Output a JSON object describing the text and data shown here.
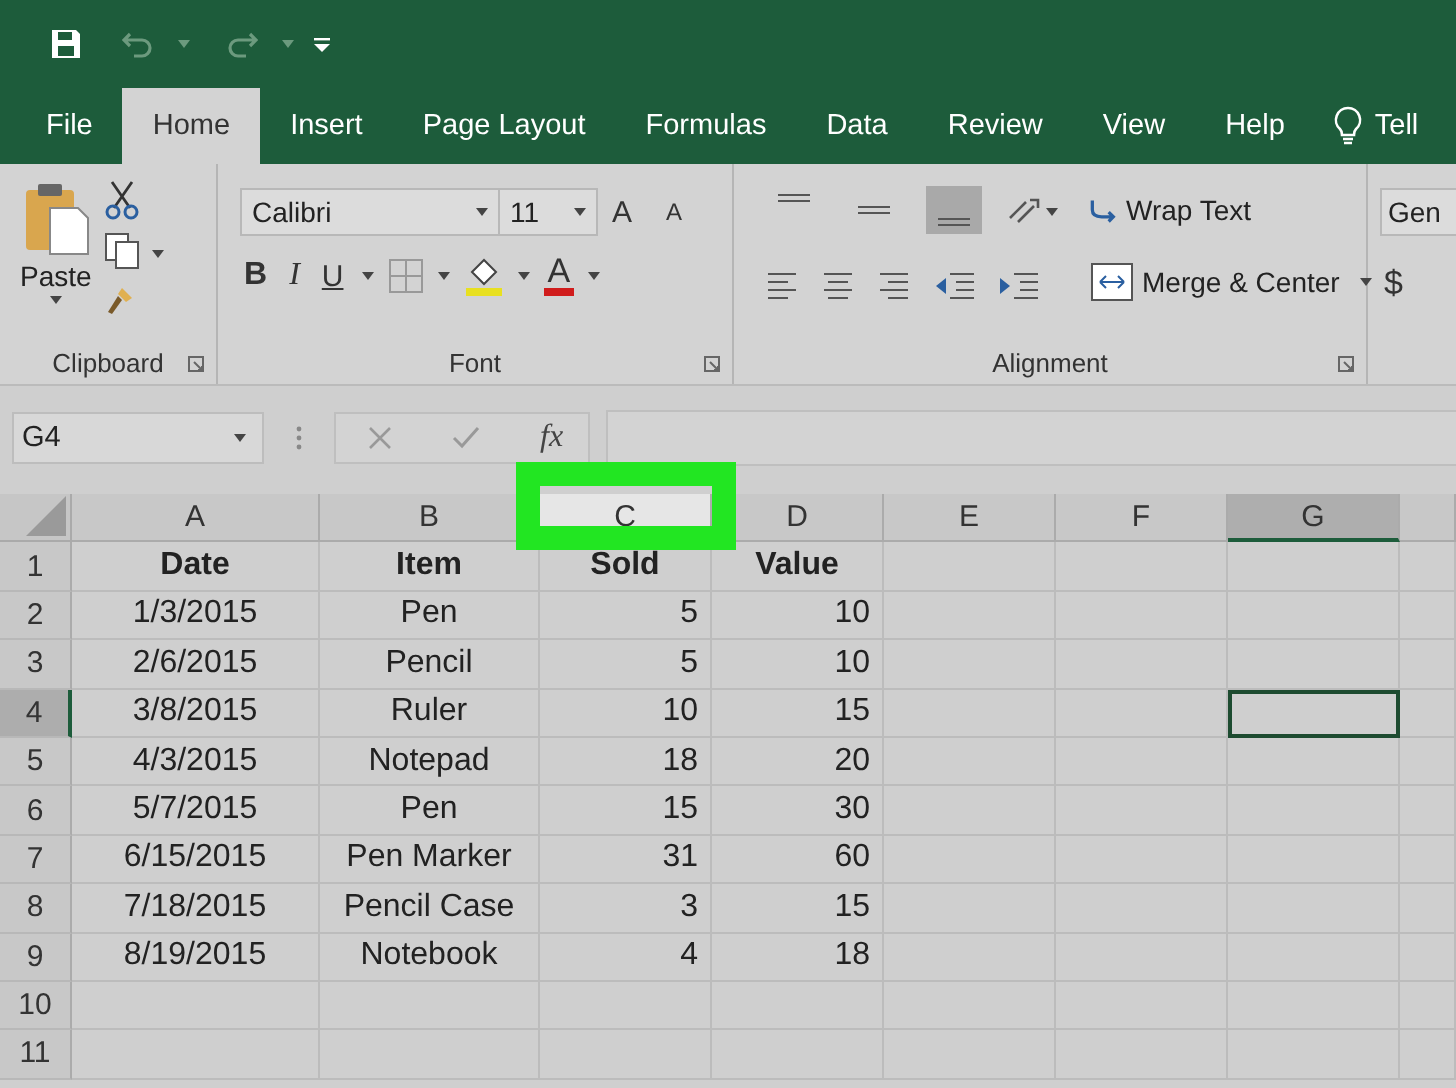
{
  "tabs": [
    {
      "label": "File",
      "selected": false
    },
    {
      "label": "Home",
      "selected": true
    },
    {
      "label": "Insert",
      "selected": false
    },
    {
      "label": "Page Layout",
      "selected": false
    },
    {
      "label": "Formulas",
      "selected": false
    },
    {
      "label": "Data",
      "selected": false
    },
    {
      "label": "Review",
      "selected": false
    },
    {
      "label": "View",
      "selected": false
    },
    {
      "label": "Help",
      "selected": false
    }
  ],
  "tell_me": "Tell",
  "ribbon": {
    "clipboard": {
      "paste": "Paste",
      "label": "Clipboard"
    },
    "font": {
      "font_name": "Calibri",
      "font_size": "11",
      "grow": "A",
      "shrink": "A",
      "bold": "B",
      "italic": "I",
      "underline": "U",
      "font_color": "A",
      "label": "Font"
    },
    "alignment": {
      "align_buttons": [
        {
          "selected": false
        },
        {
          "selected": false
        },
        {
          "selected": true
        }
      ],
      "wrap_text": "Wrap Text",
      "merge_center": "Merge & Center",
      "label": "Alignment"
    },
    "number": {
      "format": "Gen",
      "currency": "$"
    }
  },
  "formula_bar": {
    "name_box": "G4",
    "fx": "fx"
  },
  "columns": [
    {
      "label": "A",
      "selected": false,
      "highlighted": false
    },
    {
      "label": "B",
      "selected": false,
      "highlighted": false
    },
    {
      "label": "C",
      "selected": false,
      "highlighted": true
    },
    {
      "label": "D",
      "selected": false,
      "highlighted": false
    },
    {
      "label": "E",
      "selected": false,
      "highlighted": false
    },
    {
      "label": "F",
      "selected": false,
      "highlighted": false
    },
    {
      "label": "G",
      "selected": true,
      "highlighted": false
    }
  ],
  "rows": [
    {
      "number": "1",
      "selected": false,
      "cells": [
        "Date",
        "Item",
        "Sold",
        "Value"
      ]
    },
    {
      "number": "2",
      "selected": false,
      "cells": [
        "1/3/2015",
        "Pen",
        "5",
        "10"
      ]
    },
    {
      "number": "3",
      "selected": false,
      "cells": [
        "2/6/2015",
        "Pencil",
        "5",
        "10"
      ]
    },
    {
      "number": "4",
      "selected": true,
      "cells": [
        "3/8/2015",
        "Ruler",
        "10",
        "15"
      ]
    },
    {
      "number": "5",
      "selected": false,
      "cells": [
        "4/3/2015",
        "Notepad",
        "18",
        "20"
      ]
    },
    {
      "number": "6",
      "selected": false,
      "cells": [
        "5/7/2015",
        "Pen",
        "15",
        "30"
      ]
    },
    {
      "number": "7",
      "selected": false,
      "cells": [
        "6/15/2015",
        "Pen Marker",
        "31",
        "60"
      ]
    },
    {
      "number": "8",
      "selected": false,
      "cells": [
        "7/18/2015",
        "Pencil Case",
        "3",
        "15"
      ]
    },
    {
      "number": "9",
      "selected": false,
      "cells": [
        "8/19/2015",
        "Notebook",
        "4",
        "18"
      ]
    },
    {
      "number": "10",
      "selected": false,
      "cells": []
    },
    {
      "number": "11",
      "selected": false,
      "cells": []
    }
  ]
}
